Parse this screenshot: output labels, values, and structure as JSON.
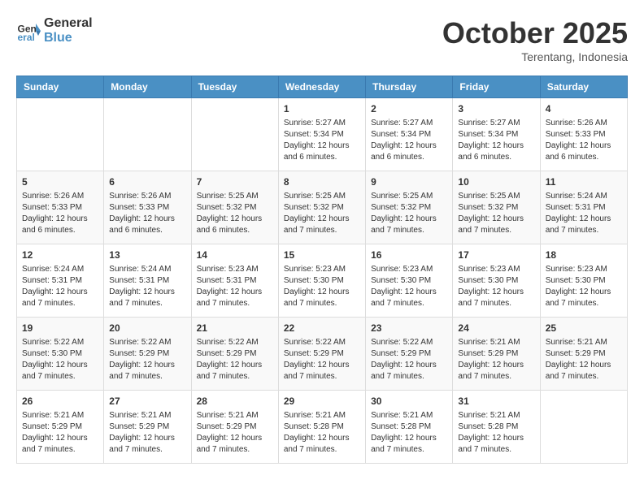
{
  "header": {
    "logo_line1": "General",
    "logo_line2": "Blue",
    "month": "October 2025",
    "location": "Terentang, Indonesia"
  },
  "days_of_week": [
    "Sunday",
    "Monday",
    "Tuesday",
    "Wednesday",
    "Thursday",
    "Friday",
    "Saturday"
  ],
  "weeks": [
    [
      {
        "day": "",
        "info": ""
      },
      {
        "day": "",
        "info": ""
      },
      {
        "day": "",
        "info": ""
      },
      {
        "day": "1",
        "info": "Sunrise: 5:27 AM\nSunset: 5:34 PM\nDaylight: 12 hours\nand 6 minutes."
      },
      {
        "day": "2",
        "info": "Sunrise: 5:27 AM\nSunset: 5:34 PM\nDaylight: 12 hours\nand 6 minutes."
      },
      {
        "day": "3",
        "info": "Sunrise: 5:27 AM\nSunset: 5:34 PM\nDaylight: 12 hours\nand 6 minutes."
      },
      {
        "day": "4",
        "info": "Sunrise: 5:26 AM\nSunset: 5:33 PM\nDaylight: 12 hours\nand 6 minutes."
      }
    ],
    [
      {
        "day": "5",
        "info": "Sunrise: 5:26 AM\nSunset: 5:33 PM\nDaylight: 12 hours\nand 6 minutes."
      },
      {
        "day": "6",
        "info": "Sunrise: 5:26 AM\nSunset: 5:33 PM\nDaylight: 12 hours\nand 6 minutes."
      },
      {
        "day": "7",
        "info": "Sunrise: 5:25 AM\nSunset: 5:32 PM\nDaylight: 12 hours\nand 6 minutes."
      },
      {
        "day": "8",
        "info": "Sunrise: 5:25 AM\nSunset: 5:32 PM\nDaylight: 12 hours\nand 7 minutes."
      },
      {
        "day": "9",
        "info": "Sunrise: 5:25 AM\nSunset: 5:32 PM\nDaylight: 12 hours\nand 7 minutes."
      },
      {
        "day": "10",
        "info": "Sunrise: 5:25 AM\nSunset: 5:32 PM\nDaylight: 12 hours\nand 7 minutes."
      },
      {
        "day": "11",
        "info": "Sunrise: 5:24 AM\nSunset: 5:31 PM\nDaylight: 12 hours\nand 7 minutes."
      }
    ],
    [
      {
        "day": "12",
        "info": "Sunrise: 5:24 AM\nSunset: 5:31 PM\nDaylight: 12 hours\nand 7 minutes."
      },
      {
        "day": "13",
        "info": "Sunrise: 5:24 AM\nSunset: 5:31 PM\nDaylight: 12 hours\nand 7 minutes."
      },
      {
        "day": "14",
        "info": "Sunrise: 5:23 AM\nSunset: 5:31 PM\nDaylight: 12 hours\nand 7 minutes."
      },
      {
        "day": "15",
        "info": "Sunrise: 5:23 AM\nSunset: 5:30 PM\nDaylight: 12 hours\nand 7 minutes."
      },
      {
        "day": "16",
        "info": "Sunrise: 5:23 AM\nSunset: 5:30 PM\nDaylight: 12 hours\nand 7 minutes."
      },
      {
        "day": "17",
        "info": "Sunrise: 5:23 AM\nSunset: 5:30 PM\nDaylight: 12 hours\nand 7 minutes."
      },
      {
        "day": "18",
        "info": "Sunrise: 5:23 AM\nSunset: 5:30 PM\nDaylight: 12 hours\nand 7 minutes."
      }
    ],
    [
      {
        "day": "19",
        "info": "Sunrise: 5:22 AM\nSunset: 5:30 PM\nDaylight: 12 hours\nand 7 minutes."
      },
      {
        "day": "20",
        "info": "Sunrise: 5:22 AM\nSunset: 5:29 PM\nDaylight: 12 hours\nand 7 minutes."
      },
      {
        "day": "21",
        "info": "Sunrise: 5:22 AM\nSunset: 5:29 PM\nDaylight: 12 hours\nand 7 minutes."
      },
      {
        "day": "22",
        "info": "Sunrise: 5:22 AM\nSunset: 5:29 PM\nDaylight: 12 hours\nand 7 minutes."
      },
      {
        "day": "23",
        "info": "Sunrise: 5:22 AM\nSunset: 5:29 PM\nDaylight: 12 hours\nand 7 minutes."
      },
      {
        "day": "24",
        "info": "Sunrise: 5:21 AM\nSunset: 5:29 PM\nDaylight: 12 hours\nand 7 minutes."
      },
      {
        "day": "25",
        "info": "Sunrise: 5:21 AM\nSunset: 5:29 PM\nDaylight: 12 hours\nand 7 minutes."
      }
    ],
    [
      {
        "day": "26",
        "info": "Sunrise: 5:21 AM\nSunset: 5:29 PM\nDaylight: 12 hours\nand 7 minutes."
      },
      {
        "day": "27",
        "info": "Sunrise: 5:21 AM\nSunset: 5:29 PM\nDaylight: 12 hours\nand 7 minutes."
      },
      {
        "day": "28",
        "info": "Sunrise: 5:21 AM\nSunset: 5:29 PM\nDaylight: 12 hours\nand 7 minutes."
      },
      {
        "day": "29",
        "info": "Sunrise: 5:21 AM\nSunset: 5:28 PM\nDaylight: 12 hours\nand 7 minutes."
      },
      {
        "day": "30",
        "info": "Sunrise: 5:21 AM\nSunset: 5:28 PM\nDaylight: 12 hours\nand 7 minutes."
      },
      {
        "day": "31",
        "info": "Sunrise: 5:21 AM\nSunset: 5:28 PM\nDaylight: 12 hours\nand 7 minutes."
      },
      {
        "day": "",
        "info": ""
      }
    ]
  ]
}
